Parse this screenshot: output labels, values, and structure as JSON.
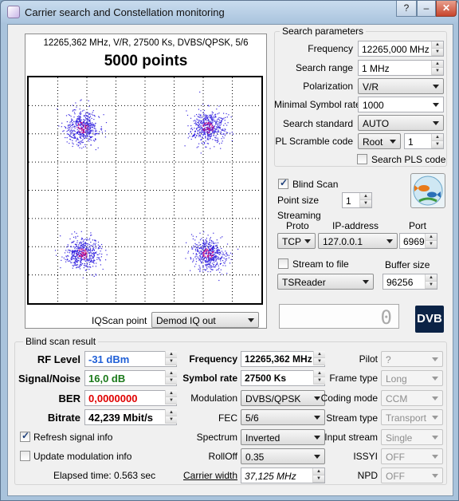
{
  "window": {
    "title": "Carrier search and Constellation monitoring",
    "help": "?",
    "minimize": "–",
    "close": "✕"
  },
  "scope": {
    "info": "12265,362 MHz, V/R, 27500 Ks, DVBS/QPSK, 5/6",
    "points": "5000 points"
  },
  "search": {
    "title": "Search parameters",
    "frequency_label": "Frequency",
    "frequency_value": "12265,000 MHz",
    "range_label": "Search range",
    "range_value": "1 MHz",
    "polarization_label": "Polarization",
    "polarization_value": "V/R",
    "minsr_label": "Minimal Symbol rate",
    "minsr_value": "1000",
    "standard_label": "Search standard",
    "standard_value": "AUTO",
    "pls_label": "PL Scramble code",
    "pls_mode": "Root",
    "pls_value": "1",
    "search_pls_label": "Search PLS code"
  },
  "blind": {
    "label": "Blind Scan",
    "checked": true,
    "point_size_label": "Point size",
    "point_size_value": "1"
  },
  "streaming": {
    "title": "Streaming",
    "proto_label": "Proto",
    "proto_value": "TCP",
    "ip_label": "IP-address",
    "ip_value": "127.0.0.1",
    "port_label": "Port",
    "port_value": "6969",
    "stream_to_file_label": "Stream to file",
    "stream_to_file_checked": false,
    "buffer_label": "Buffer size",
    "player_value": "TSReader",
    "buffer_value": "96256"
  },
  "digital_display": "0",
  "dvb_logo": "DVB",
  "iq": {
    "label": "IQScan point",
    "value": "Demod IQ out"
  },
  "result": {
    "title": "Blind scan result",
    "rf_label": "RF Level",
    "rf_value": "-31 dBm",
    "sn_label": "Signal/Noise",
    "sn_value": "16,0 dB",
    "ber_label": "BER",
    "ber_value": "0,0000000",
    "bitrate_label": "Bitrate",
    "bitrate_value": "42,239 Mbit/s",
    "refresh_label": "Refresh signal info",
    "refresh_checked": true,
    "update_label": "Update modulation info",
    "update_checked": false,
    "elapsed": "Elapsed time: 0.563 sec",
    "freq_label": "Frequency",
    "freq_value": "12265,362 MHz",
    "sr_label": "Symbol rate",
    "sr_value": "27500 Ks",
    "mod_label": "Modulation",
    "mod_value": "DVBS/QPSK",
    "fec_label": "FEC",
    "fec_value": "5/6",
    "spectrum_label": "Spectrum",
    "spectrum_value": "Inverted",
    "rolloff_label": "RollOff",
    "rolloff_value": "0.35",
    "cw_label": "Carrier width",
    "cw_value": "37,125 MHz",
    "pilot_label": "Pilot",
    "pilot_value": "?",
    "frame_label": "Frame type",
    "frame_value": "Long",
    "coding_label": "Coding mode",
    "coding_value": "CCM",
    "stype_label": "Stream type",
    "stype_value": "Transport",
    "istream_label": "Input stream",
    "istream_value": "Single",
    "issyi_label": "ISSYI",
    "issyi_value": "OFF",
    "npd_label": "NPD",
    "npd_value": "OFF"
  },
  "colors": {
    "rf": "#1f5fd6",
    "sn": "#1c7a1c",
    "ber": "#e00000",
    "dots": "#3b2be0",
    "dots_center": "#c00080"
  },
  "constellation": {
    "clusters": [
      {
        "i": -1,
        "q": 1
      },
      {
        "i": 1,
        "q": 1
      },
      {
        "i": -1,
        "q": -1
      },
      {
        "i": 1,
        "q": -1
      }
    ]
  }
}
